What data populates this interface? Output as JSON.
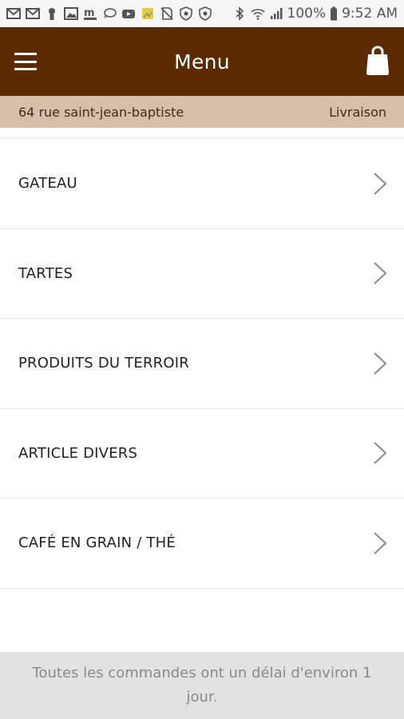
{
  "status_bar": {
    "battery_text": "100%",
    "time": "9:52 AM"
  },
  "app_bar": {
    "title": "Menu",
    "menu_icon": "hamburger-icon",
    "cart_icon": "shopping-bag-icon"
  },
  "address_bar": {
    "address": "64 rue saint-jean-baptiste",
    "mode": "Livraison"
  },
  "categories": [
    {
      "label": "GATEAU"
    },
    {
      "label": "TARTES"
    },
    {
      "label": "PRODUITS DU TERROIR"
    },
    {
      "label": "ARTICLE DIVERS"
    },
    {
      "label": "CAFÉ EN GRAIN / THÉ"
    }
  ],
  "footer": {
    "note": "Toutes les commandes ont un délai d'environ 1 jour."
  },
  "colors": {
    "app_bar": "#5a2b00",
    "address_bar": "#d6bfa8",
    "footer": "#e2e2e2"
  }
}
